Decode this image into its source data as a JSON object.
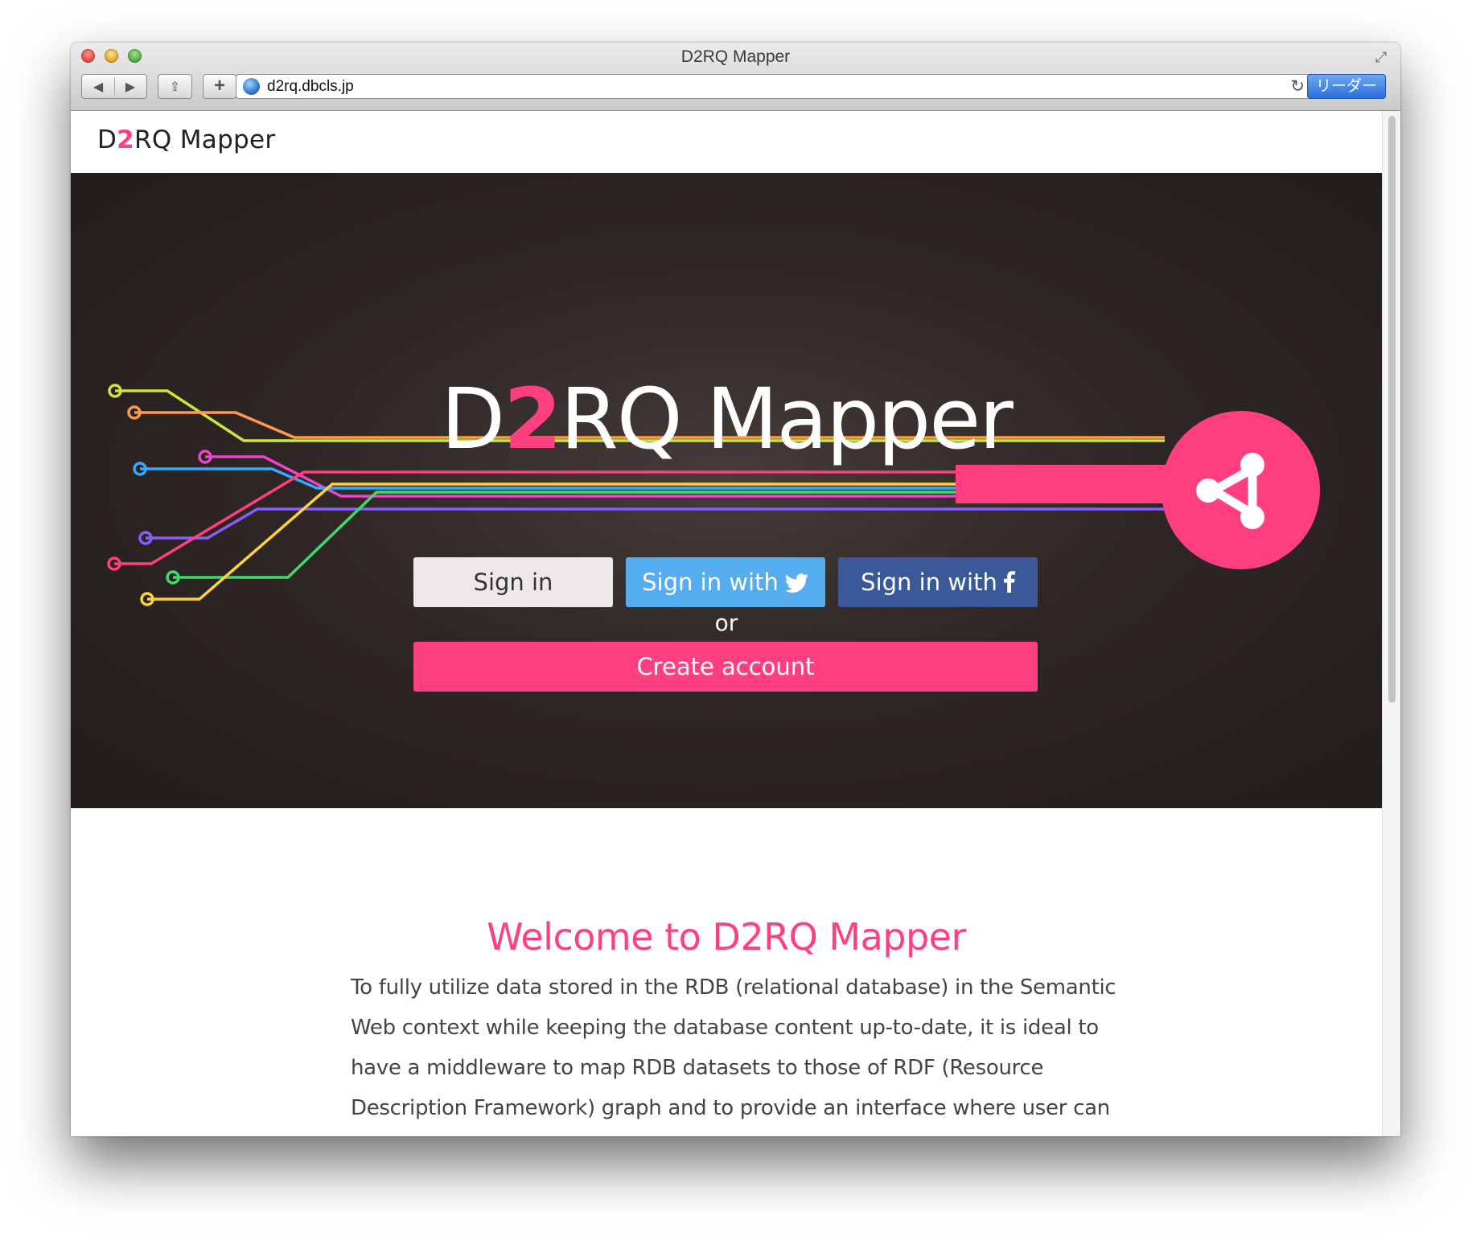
{
  "browser": {
    "window_title": "D2RQ Mapper",
    "url": "d2rq.dbcls.jp",
    "reader_label": "リーダー",
    "back_glyph": "◀",
    "forward_glyph": "▶",
    "share_glyph": "⇪",
    "newtab_glyph": "+",
    "reload_glyph": "↻",
    "fullscreen_glyph": "⤢"
  },
  "header": {
    "brand_prefix": "D",
    "brand_accent": "2",
    "brand_suffix": "RQ Mapper"
  },
  "hero": {
    "title_prefix": "D",
    "title_accent": "2",
    "title_suffix": "RQ Mapper",
    "signin_label": "Sign in",
    "twitter_label": "Sign in with",
    "facebook_label": "Sign in with",
    "or_label": "or",
    "create_label": "Create account"
  },
  "content": {
    "welcome_title": "Welcome to D2RQ Mapper",
    "intro_text": "To fully utilize data stored in the RDB (relational database) in the Semantic Web context while keeping the database content up-to-date, it is ideal to have a middleware to map RDB datasets to those of RDF (Resource Description Framework) graph and to provide an interface where user can access to the RDB using SPARQL (SPARQL Protocol and RDF Query Language)."
  },
  "colors": {
    "accent": "#ff3f82",
    "twitter": "#55acee",
    "facebook": "#3b5998",
    "hero_bg": "#2a2321"
  },
  "icons": [
    "globe-icon",
    "reload-icon",
    "twitter-icon",
    "facebook-icon",
    "share-graph-icon"
  ]
}
